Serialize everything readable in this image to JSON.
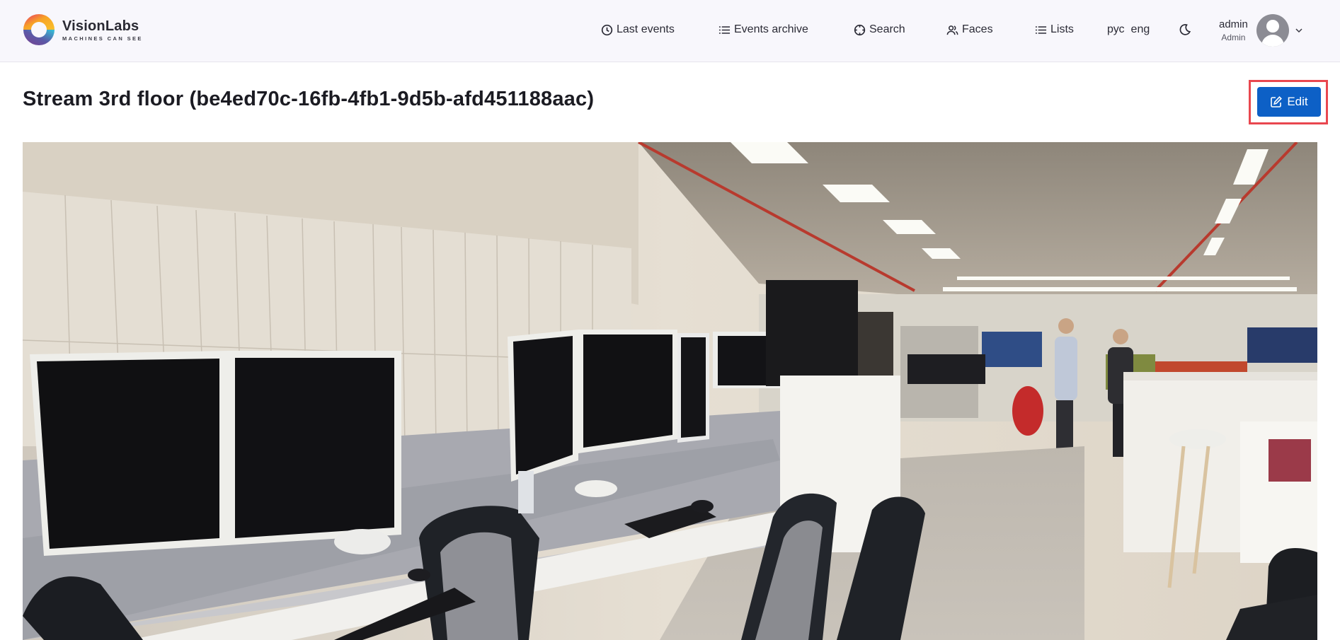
{
  "app": {
    "brand_name": "VisionLabs",
    "brand_tagline": "MACHINES CAN SEE"
  },
  "nav": {
    "items": [
      {
        "label": "Last events",
        "icon": "clock-icon"
      },
      {
        "label": "Events archive",
        "icon": "list-icon"
      },
      {
        "label": "Search",
        "icon": "crosshair-icon"
      },
      {
        "label": "Faces",
        "icon": "users-icon"
      },
      {
        "label": "Lists",
        "icon": "list-icon"
      }
    ],
    "languages": [
      "рус",
      "eng"
    ],
    "theme_toggle_icon": "moon-icon"
  },
  "user": {
    "name": "admin",
    "role": "Admin",
    "avatar_icon": "user-avatar-icon"
  },
  "page": {
    "title": "Stream 3rd floor (be4ed70c-16fb-4fb1-9d5b-afd451188aac)",
    "edit_label": "Edit",
    "edit_icon": "edit-icon",
    "accent_color": "#0d60c6",
    "highlight_color": "#e9474f"
  },
  "stream": {
    "description": "Office open-plan floor with desks, dual monitors, chairs and two people standing in the aisle"
  }
}
